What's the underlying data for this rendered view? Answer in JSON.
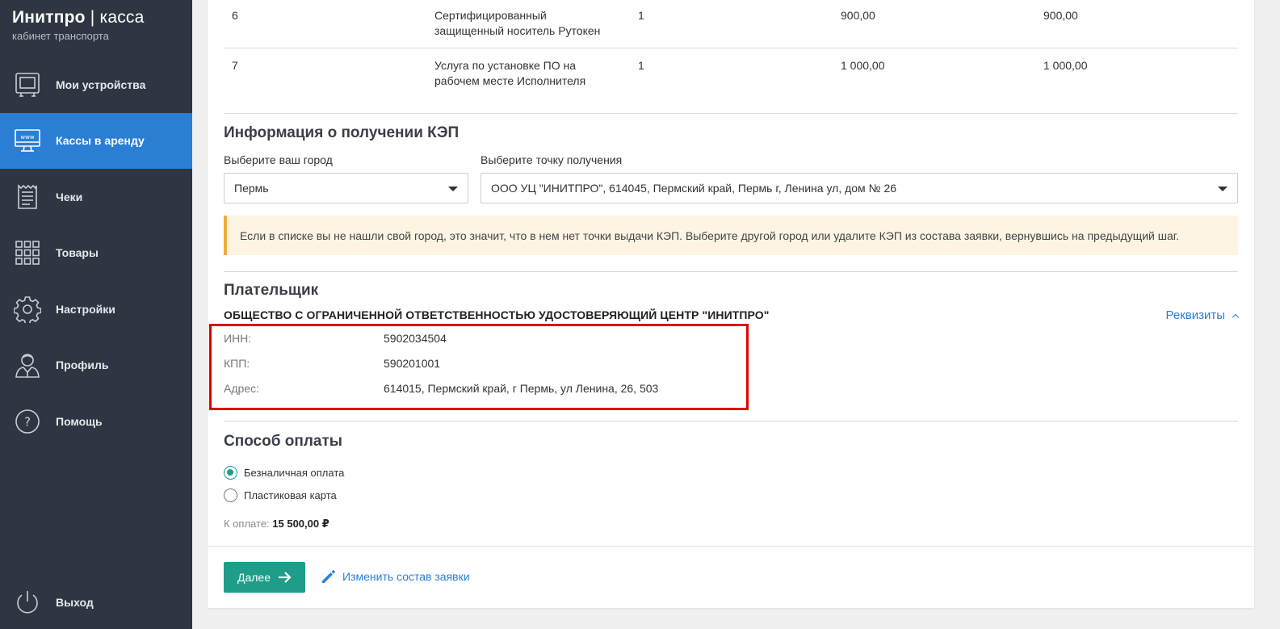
{
  "brand": {
    "title_strong": "Инитпро",
    "separator": "|",
    "title_light": "касса",
    "subtitle": "кабинет транспорта"
  },
  "sidebar": {
    "items": [
      {
        "label": "Мои устройства",
        "icon": "device-icon",
        "active": false
      },
      {
        "label": "Кассы в аренду",
        "icon": "www-monitor-icon",
        "active": true
      },
      {
        "label": "Чеки",
        "icon": "receipt-icon",
        "active": false
      },
      {
        "label": "Товары",
        "icon": "grid-icon",
        "active": false
      },
      {
        "label": "Настройки",
        "icon": "gear-icon",
        "active": false
      },
      {
        "label": "Профиль",
        "icon": "user-icon",
        "active": false
      },
      {
        "label": "Помощь",
        "icon": "help-icon",
        "active": false
      }
    ],
    "logout": {
      "label": "Выход",
      "icon": "power-icon"
    }
  },
  "order_table": {
    "rows": [
      {
        "num": "6",
        "name_line1": "Сертифицированный",
        "name_line2": "защищенный носитель Рутокен",
        "qty": "1",
        "price": "900,00",
        "sum": "900,00"
      },
      {
        "num": "7",
        "name_line1": "Услуга по установке ПО на",
        "name_line2": "рабочем месте Исполнителя",
        "qty": "1",
        "price": "1 000,00",
        "sum": "1 000,00"
      }
    ]
  },
  "kep": {
    "title": "Информация о получении КЭП",
    "city_label": "Выберите ваш город",
    "city_value": "Пермь",
    "point_label": "Выберите точку получения",
    "point_value": "ООО УЦ \"ИНИТПРО\", 614045, Пермский край, Пермь г, Ленина ул, дом № 26",
    "notice": "Если в списке вы не нашли свой город, это значит, что в нем нет точки выдачи КЭП. Выберите другой город или удалите КЭП из состава заявки, вернувшись на предыдущий шаг."
  },
  "payer": {
    "title": "Плательщик",
    "name": "ОБЩЕСТВО С ОГРАНИЧЕННОЙ ОТВЕТСТВЕННОСТЬЮ УДОСТОВЕРЯЮЩИЙ ЦЕНТР \"ИНИТПРО\"",
    "details_link": "Реквизиты",
    "inn_label": "ИНН:",
    "inn_value": "5902034504",
    "kpp_label": "КПП:",
    "kpp_value": "590201001",
    "address_label": "Адрес:",
    "address_value": "614015, Пермский край, г Пермь, ул Ленина, 26, 503"
  },
  "payment": {
    "title": "Способ оплаты",
    "options": [
      {
        "label": "Безналичная оплата",
        "checked": true
      },
      {
        "label": "Пластиковая карта",
        "checked": false
      }
    ],
    "total_label": "К оплате:",
    "total_value": "15 500,00 ₽"
  },
  "actions": {
    "next_label": "Далее",
    "edit_label": "Изменить состав заявки"
  },
  "colors": {
    "sidebar_bg": "#2f3542",
    "active_blue": "#2a7fd4",
    "teal": "#1f9d8a",
    "highlight_red": "#e00000",
    "notice_bg": "#fdf4e3"
  }
}
